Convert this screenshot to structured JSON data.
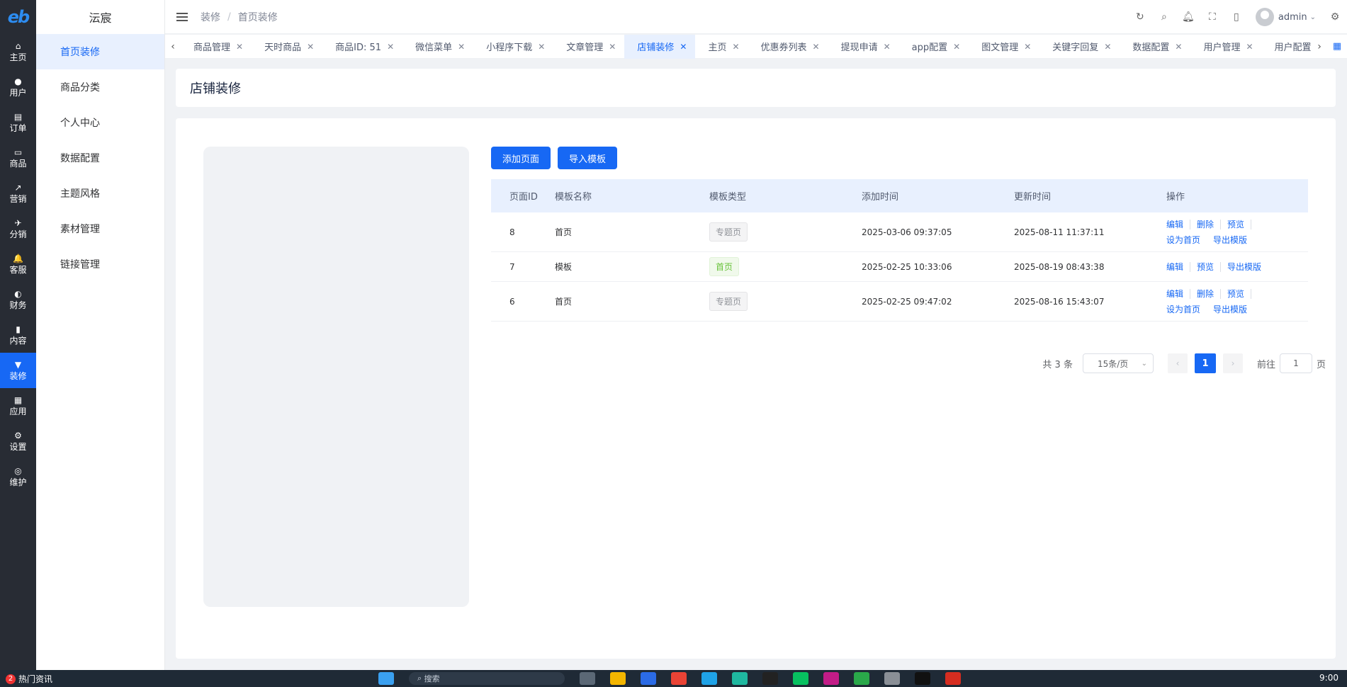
{
  "app": {
    "logo": "eb",
    "title": "沄宸"
  },
  "rail": [
    {
      "icon": "⌂",
      "label": "主页"
    },
    {
      "icon": "●",
      "label": "用户"
    },
    {
      "icon": "▤",
      "label": "订单"
    },
    {
      "icon": "▭",
      "label": "商品"
    },
    {
      "icon": "↗",
      "label": "营销"
    },
    {
      "icon": "✈",
      "label": "分销"
    },
    {
      "icon": "🔔",
      "label": "客服"
    },
    {
      "icon": "◐",
      "label": "财务"
    },
    {
      "icon": "▮",
      "label": "内容"
    },
    {
      "icon": "▼",
      "label": "装修"
    },
    {
      "icon": "▦",
      "label": "应用"
    },
    {
      "icon": "⚙",
      "label": "设置"
    },
    {
      "icon": "◎",
      "label": "维护"
    }
  ],
  "submenu": [
    "首页装修",
    "商品分类",
    "个人中心",
    "数据配置",
    "主题风格",
    "素材管理",
    "链接管理"
  ],
  "breadcrumb": [
    "装修",
    "首页装修"
  ],
  "header": {
    "user": "admin"
  },
  "tabs": [
    "商品管理",
    "天时商品",
    "商品ID: 51",
    "微信菜单",
    "小程序下载",
    "文章管理",
    "店铺装修",
    "主页",
    "优惠券列表",
    "提现申请",
    "app配置",
    "图文管理",
    "关键字回复",
    "数据配置",
    "用户管理",
    "用户配置"
  ],
  "page": {
    "title": "店铺装修"
  },
  "buttons": {
    "add": "添加页面",
    "import": "导入模板"
  },
  "table": {
    "headers": [
      "页面ID",
      "模板名称",
      "模板类型",
      "添加时间",
      "更新时间",
      "操作"
    ],
    "rows": [
      {
        "id": "8",
        "name": "首页",
        "type": "专题页",
        "type_color": "#909399",
        "added": "2025-03-06 09:37:05",
        "updated": "2025-08-11 11:37:11",
        "ops": [
          "编辑",
          "删除",
          "预览",
          "设为首页",
          "导出模版"
        ]
      },
      {
        "id": "7",
        "name": "模板",
        "type": "首页",
        "type_color": "#67c23a",
        "added": "2025-02-25 10:33:06",
        "updated": "2025-08-19 08:43:38",
        "ops": [
          "编辑",
          "预览",
          "导出模版"
        ]
      },
      {
        "id": "6",
        "name": "首页",
        "type": "专题页",
        "type_color": "#909399",
        "added": "2025-02-25 09:47:02",
        "updated": "2025-08-16 15:43:07",
        "ops": [
          "编辑",
          "删除",
          "预览",
          "设为首页",
          "导出模版"
        ]
      }
    ]
  },
  "pagination": {
    "total": "共 3 条",
    "page_size": "15条/页",
    "current": "1",
    "goto_label": "前往",
    "goto_value": "1",
    "page_suffix": "页"
  },
  "taskbar": {
    "badge": "2",
    "news": "热门资讯",
    "search": "搜索",
    "time": "9:00"
  }
}
